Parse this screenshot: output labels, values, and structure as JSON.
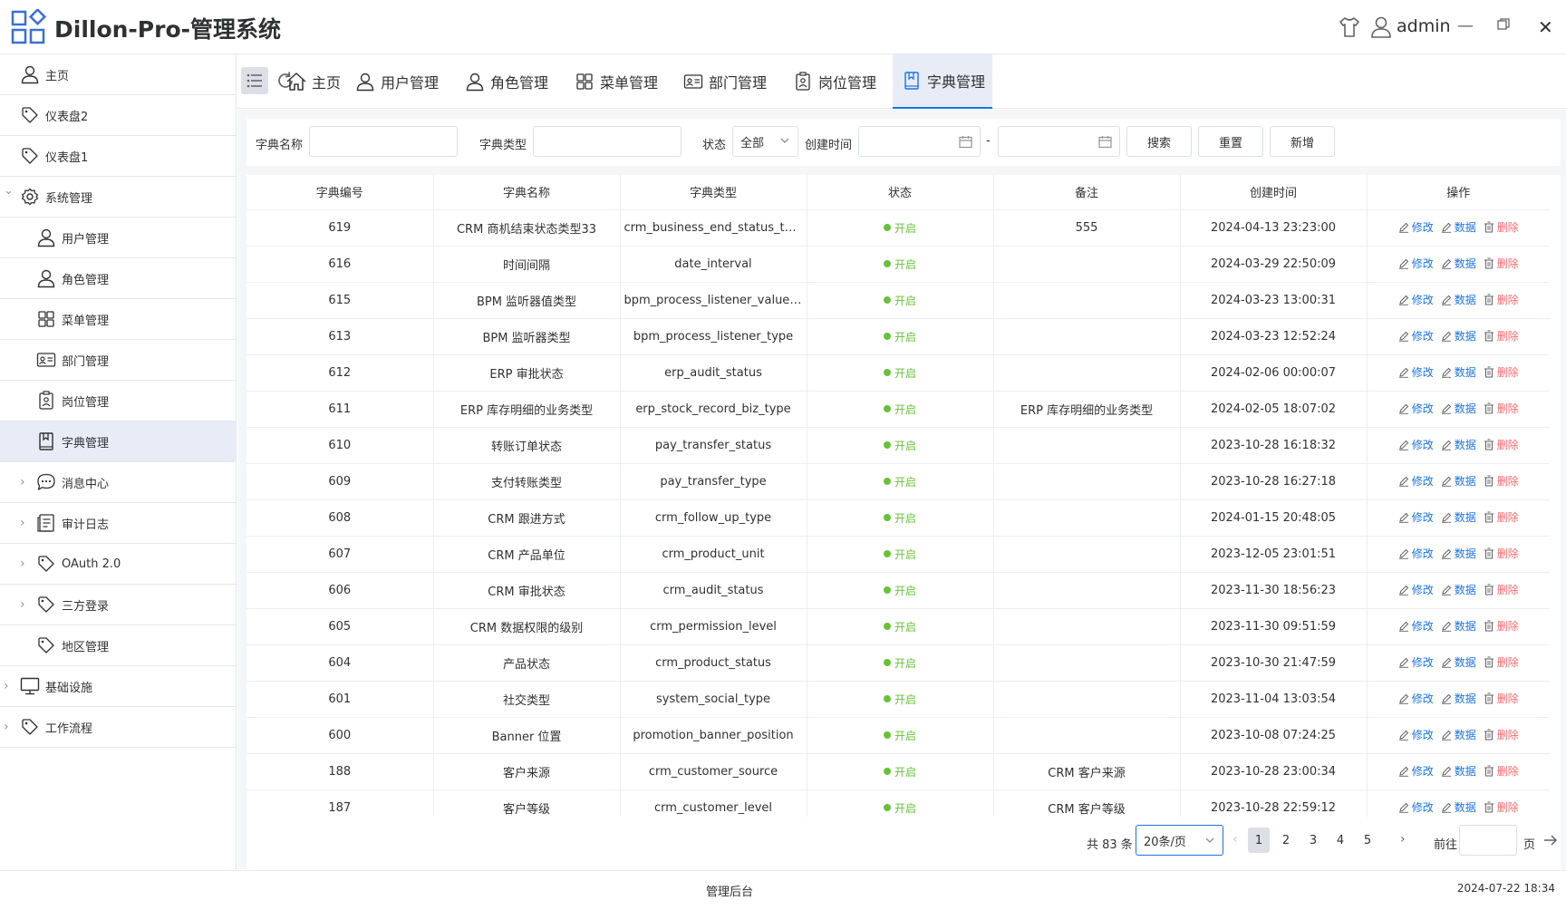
{
  "header": {
    "title": "Dillon-Pro-管理系统",
    "username": "admin"
  },
  "sidebar": {
    "items": [
      {
        "label": "主页",
        "icon": "user-icon",
        "level": 0,
        "expandable": false
      },
      {
        "label": "仪表盘2",
        "icon": "tag-icon",
        "level": 0,
        "expandable": false
      },
      {
        "label": "仪表盘1",
        "icon": "tag-icon",
        "level": 0,
        "expandable": false
      },
      {
        "label": "系统管理",
        "icon": "gear-icon",
        "level": 0,
        "expandable": true,
        "expanded": true
      },
      {
        "label": "用户管理",
        "icon": "user-icon",
        "level": 1,
        "expandable": false
      },
      {
        "label": "角色管理",
        "icon": "user-icon",
        "level": 1,
        "expandable": false
      },
      {
        "label": "菜单管理",
        "icon": "grid-icon",
        "level": 1,
        "expandable": false
      },
      {
        "label": "部门管理",
        "icon": "id-card-icon",
        "level": 1,
        "expandable": false
      },
      {
        "label": "岗位管理",
        "icon": "badge-icon",
        "level": 1,
        "expandable": false
      },
      {
        "label": "字典管理",
        "icon": "book-icon",
        "level": 1,
        "expandable": false,
        "active": true
      },
      {
        "label": "消息中心",
        "icon": "chat-icon",
        "level": 1,
        "expandable": true
      },
      {
        "label": "审计日志",
        "icon": "log-icon",
        "level": 1,
        "expandable": true
      },
      {
        "label": "OAuth 2.0",
        "icon": "tag-icon",
        "level": 1,
        "expandable": true
      },
      {
        "label": "三方登录",
        "icon": "tag-icon",
        "level": 1,
        "expandable": true
      },
      {
        "label": "地区管理",
        "icon": "tag-icon",
        "level": 1,
        "expandable": false
      },
      {
        "label": "基础设施",
        "icon": "monitor-icon",
        "level": 0,
        "expandable": true
      },
      {
        "label": "工作流程",
        "icon": "tag-icon",
        "level": 0,
        "expandable": true
      }
    ]
  },
  "tabs": [
    {
      "label": "主页",
      "icon": "home-icon"
    },
    {
      "label": "用户管理",
      "icon": "user-icon"
    },
    {
      "label": "角色管理",
      "icon": "user-icon"
    },
    {
      "label": "菜单管理",
      "icon": "grid-icon"
    },
    {
      "label": "部门管理",
      "icon": "id-card-icon"
    },
    {
      "label": "岗位管理",
      "icon": "badge-icon"
    },
    {
      "label": "字典管理",
      "icon": "book-icon",
      "active": true
    }
  ],
  "filter": {
    "name_label": "字典名称",
    "name_value": "",
    "type_label": "字典类型",
    "type_value": "",
    "status_label": "状态",
    "status_value": "全部",
    "time_label": "创建时间",
    "date_sep": "-",
    "search_btn": "搜索",
    "reset_btn": "重置",
    "add_btn": "新增"
  },
  "table": {
    "columns": [
      "字典编号",
      "字典名称",
      "字典类型",
      "状态",
      "备注",
      "创建时间",
      "操作"
    ],
    "rows": [
      {
        "id": "619",
        "name": "CRM 商机结束状态类型33",
        "type": "crm_business_end_status_type",
        "status": "开启",
        "remark": "555",
        "created": "2024-04-13 23:23:00"
      },
      {
        "id": "616",
        "name": "时间间隔",
        "type": "date_interval",
        "status": "开启",
        "remark": "",
        "created": "2024-03-29 22:50:09"
      },
      {
        "id": "615",
        "name": "BPM 监听器值类型",
        "type": "bpm_process_listener_value_ty...",
        "status": "开启",
        "remark": "",
        "created": "2024-03-23 13:00:31"
      },
      {
        "id": "613",
        "name": "BPM 监听器类型",
        "type": "bpm_process_listener_type",
        "status": "开启",
        "remark": "",
        "created": "2024-03-23 12:52:24"
      },
      {
        "id": "612",
        "name": "ERP 审批状态",
        "type": "erp_audit_status",
        "status": "开启",
        "remark": "",
        "created": "2024-02-06 00:00:07"
      },
      {
        "id": "611",
        "name": "ERP 库存明细的业务类型",
        "type": "erp_stock_record_biz_type",
        "status": "开启",
        "remark": "ERP 库存明细的业务类型",
        "created": "2024-02-05 18:07:02"
      },
      {
        "id": "610",
        "name": "转账订单状态",
        "type": "pay_transfer_status",
        "status": "开启",
        "remark": "",
        "created": "2023-10-28 16:18:32"
      },
      {
        "id": "609",
        "name": "支付转账类型",
        "type": "pay_transfer_type",
        "status": "开启",
        "remark": "",
        "created": "2023-10-28 16:27:18"
      },
      {
        "id": "608",
        "name": "CRM 跟进方式",
        "type": "crm_follow_up_type",
        "status": "开启",
        "remark": "",
        "created": "2024-01-15 20:48:05"
      },
      {
        "id": "607",
        "name": "CRM 产品单位",
        "type": "crm_product_unit",
        "status": "开启",
        "remark": "",
        "created": "2023-12-05 23:01:51"
      },
      {
        "id": "606",
        "name": "CRM 审批状态",
        "type": "crm_audit_status",
        "status": "开启",
        "remark": "",
        "created": "2023-11-30 18:56:23"
      },
      {
        "id": "605",
        "name": "CRM 数据权限的级别",
        "type": "crm_permission_level",
        "status": "开启",
        "remark": "",
        "created": "2023-11-30 09:51:59"
      },
      {
        "id": "604",
        "name": "产品状态",
        "type": "crm_product_status",
        "status": "开启",
        "remark": "",
        "created": "2023-10-30 21:47:59"
      },
      {
        "id": "601",
        "name": "社交类型",
        "type": "system_social_type",
        "status": "开启",
        "remark": "",
        "created": "2023-11-04 13:03:54"
      },
      {
        "id": "600",
        "name": "Banner 位置",
        "type": "promotion_banner_position",
        "status": "开启",
        "remark": "",
        "created": "2023-10-08 07:24:25"
      },
      {
        "id": "188",
        "name": "客户来源",
        "type": "crm_customer_source",
        "status": "开启",
        "remark": "CRM 客户来源",
        "created": "2023-10-28 23:00:34"
      },
      {
        "id": "187",
        "name": "客户等级",
        "type": "crm_customer_level",
        "status": "开启",
        "remark": "CRM 客户等级",
        "created": "2023-10-28 22:59:12"
      }
    ],
    "actions": {
      "edit": "修改",
      "data": "数据",
      "delete": "删除"
    }
  },
  "pagination": {
    "total_text": "共 83 条",
    "page_size": "20条/页",
    "pages": [
      "1",
      "2",
      "3",
      "4",
      "5"
    ],
    "current": "1",
    "goto_label": "前往",
    "page_label": "页"
  },
  "footer": {
    "center": "管理后台",
    "datetime": "2024-07-22 18:34"
  },
  "colors": {
    "accent": "#1a73e8",
    "success": "#67c23a",
    "danger": "#f56c6c",
    "active_bg": "#e8ecf6"
  }
}
